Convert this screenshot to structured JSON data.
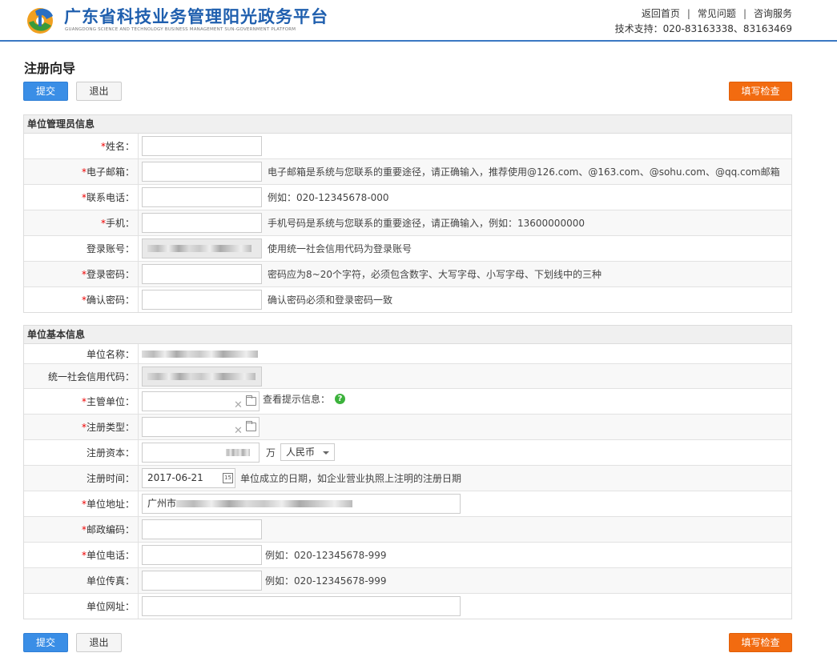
{
  "header": {
    "title_cn": "广东省科技业务管理阳光政务平台",
    "title_en": "GUANGDONG SCIENCE AND TECHNOLOGY BUSINESS MANAGEMENT SUN-GOVERNMENT PLATFORM",
    "nav": [
      "返回首页",
      "常见问题",
      "咨询服务"
    ],
    "support": "技术支持：020-83163338、83163469"
  },
  "page_title": "注册向导",
  "buttons": {
    "submit": "提交",
    "exit": "退出",
    "check": "填写检查"
  },
  "admin_section": {
    "title": "单位管理员信息",
    "fields": [
      {
        "label": "姓名：",
        "required": true,
        "value": "",
        "hint": ""
      },
      {
        "label": "电子邮箱：",
        "required": true,
        "value": "",
        "hint": "电子邮箱是系统与您联系的重要途径，请正确输入，推荐使用@126.com、@163.com、@sohu.com、@qq.com邮箱"
      },
      {
        "label": "联系电话：",
        "required": true,
        "value": "",
        "hint": "例如：020-12345678-000"
      },
      {
        "label": "手机：",
        "required": true,
        "value": "",
        "hint": "手机号码是系统与您联系的重要途径，请正确输入，例如：13600000000"
      },
      {
        "label": "登录账号：",
        "required": false,
        "value": "",
        "hint": "使用统一社会信用代码为登录账号"
      },
      {
        "label": "登录密码：",
        "required": true,
        "value": "",
        "hint": "密码应为8~20个字符，必须包含数字、大写字母、小写字母、下划线中的三种"
      },
      {
        "label": "确认密码：",
        "required": true,
        "value": "",
        "hint": "确认密码必须和登录密码一致"
      }
    ]
  },
  "basic_section": {
    "title": "单位基本信息",
    "unit_name_label": "单位名称：",
    "credit_code_label": "统一社会信用代码：",
    "supervisor_label": "主管单位：",
    "supervisor_hint": "查看提示信息：",
    "reg_type_label": "注册类型：",
    "capital_label": "注册资本：",
    "capital_unit": "万",
    "currency": "人民币",
    "reg_date_label": "注册时间：",
    "reg_date_value": "2017-06-21",
    "reg_date_hint": "单位成立的日期，如企业营业执照上注明的注册日期",
    "address_label": "单位地址：",
    "address_prefix": "广州市",
    "postcode_label": "邮政编码：",
    "phone_label": "单位电话：",
    "phone_hint": "例如：020-12345678-999",
    "fax_label": "单位传真：",
    "fax_hint": "例如：020-12345678-999",
    "website_label": "单位网址："
  }
}
